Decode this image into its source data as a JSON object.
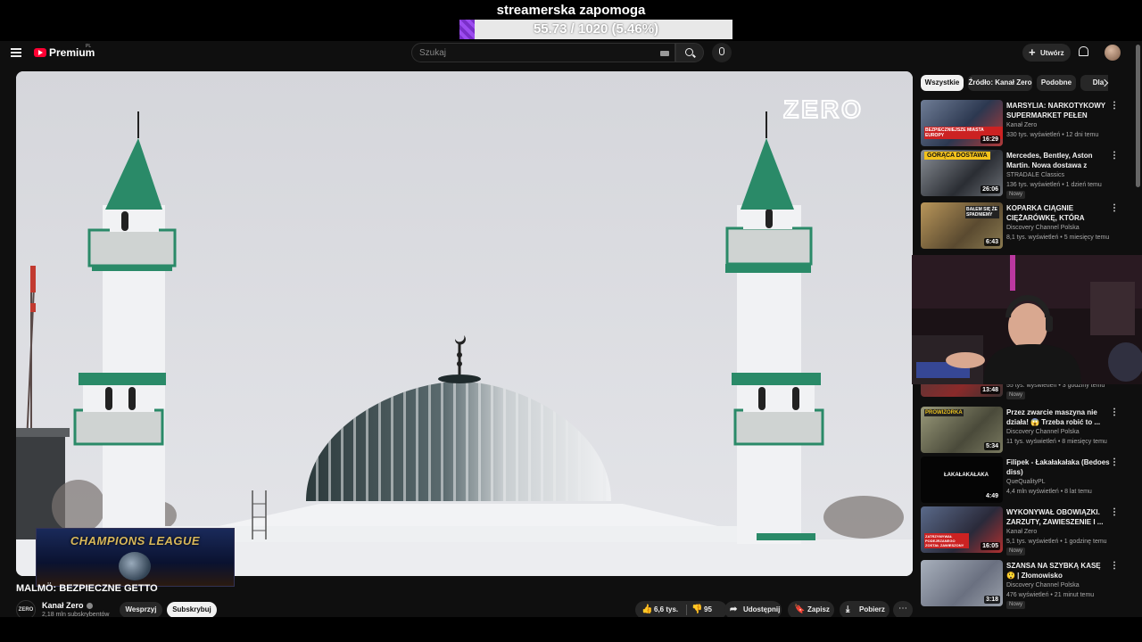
{
  "stream_overlay": {
    "title": "streamerska zapomoga",
    "progress_text": "55.73 / 1020 (5.46%)",
    "progress_fraction": 0.0546,
    "fill_color": "#8a3de0"
  },
  "header": {
    "logo_text": "Premium",
    "logo_superscript": "PL",
    "search_placeholder": "Szukaj",
    "create_label": "Utwórz"
  },
  "video": {
    "watermark": "ZERO",
    "overlay_title": "CHAMPIONS LEAGUE",
    "title": "MALMÖ: BEZPIECZNE GETTO",
    "channel_logo": "ZERO",
    "channel_name": "Kanał Zero",
    "channel_subs": "2,18 mln subskrybentów",
    "join_label": "Wesprzyj",
    "subscribe_label": "Subskrybuj",
    "likes": "6,6 tys.",
    "dislikes": "95",
    "share_label": "Udostępnij",
    "save_label": "Zapisz",
    "download_label": "Pobierz"
  },
  "sidebar": {
    "chips": [
      "Wszystkie",
      "Źródło: Kanał Zero",
      "Podobne",
      "Dla"
    ],
    "recommendations": [
      {
        "title": "MARSYLIA: NARKOTYKOWY SUPERMARKET PEŁEN BRUD...",
        "channel": "Kanał Zero",
        "meta": "330 tys. wyświetleń • 12 dni temu",
        "duration": "16:29",
        "badge": ""
      },
      {
        "title": "Mercedes, Bentley, Aston Martin. Nowa dostawa z Japonii",
        "channel": "STRADALE Classics",
        "meta": "136 tys. wyświetleń • 1 dzień temu",
        "duration": "26:06",
        "badge": "Nowy"
      },
      {
        "title": "KOPARKA CIĄGNIE CIĘŻARÓWKĘ, KTÓRA CIĄGNI...",
        "channel": "Discovery Channel Polska",
        "meta": "8,1 tys. wyświetleń • 5 miesięcy temu",
        "duration": "6:43",
        "badge": ""
      },
      {
        "title": "",
        "channel": "",
        "meta": "55 tys. wyświetleń • 3 godziny temu",
        "duration": "13:48",
        "badge": "Nowy"
      },
      {
        "title": "Przez zwarcie maszyna nie działa! 😱 Trzeba robić to ...",
        "channel": "Discovery Channel Polska",
        "meta": "11 tys. wyświetleń • 8 miesięcy temu",
        "duration": "5:34",
        "badge": ""
      },
      {
        "title": "Filipek - Łakałakałaka (Bedoes diss)",
        "channel": "QueQualityPL",
        "meta": "4,4 mln wyświetleń • 8 lat temu",
        "duration": "4:49",
        "badge": ""
      },
      {
        "title": "WYKONYWAŁ OBOWIĄZKI. ZARZUTY, ZAWIESZENIE I ...",
        "channel": "Kanał Zero",
        "meta": "5,1 tys. wyświetleń • 1 godzinę temu",
        "duration": "16:05",
        "badge": "Nowy"
      },
      {
        "title": "SZANSA NA SZYBKĄ KASĘ 😲 | Złomowisko",
        "channel": "Discovery Channel Polska",
        "meta": "476 wyświetleń • 21 minut temu",
        "duration": "3:18",
        "badge": "Nowy"
      }
    ],
    "thumb_texts": [
      "BEZPIECZNIEJSZE MIASTA EUROPY",
      "GORĄCA DOSTAWA",
      "BAŁEM SIĘ ŻE SPADNIEMY",
      "SPRAWA KOLEJNE PRZEDŁUŻENIE",
      "PROWIZORKA",
      "ŁAKAŁAKAŁAKA",
      "ZATRZYMYWAŁ PODEJRZANEGO ZOSTAŁ ZAWIESZONY",
      ""
    ]
  }
}
